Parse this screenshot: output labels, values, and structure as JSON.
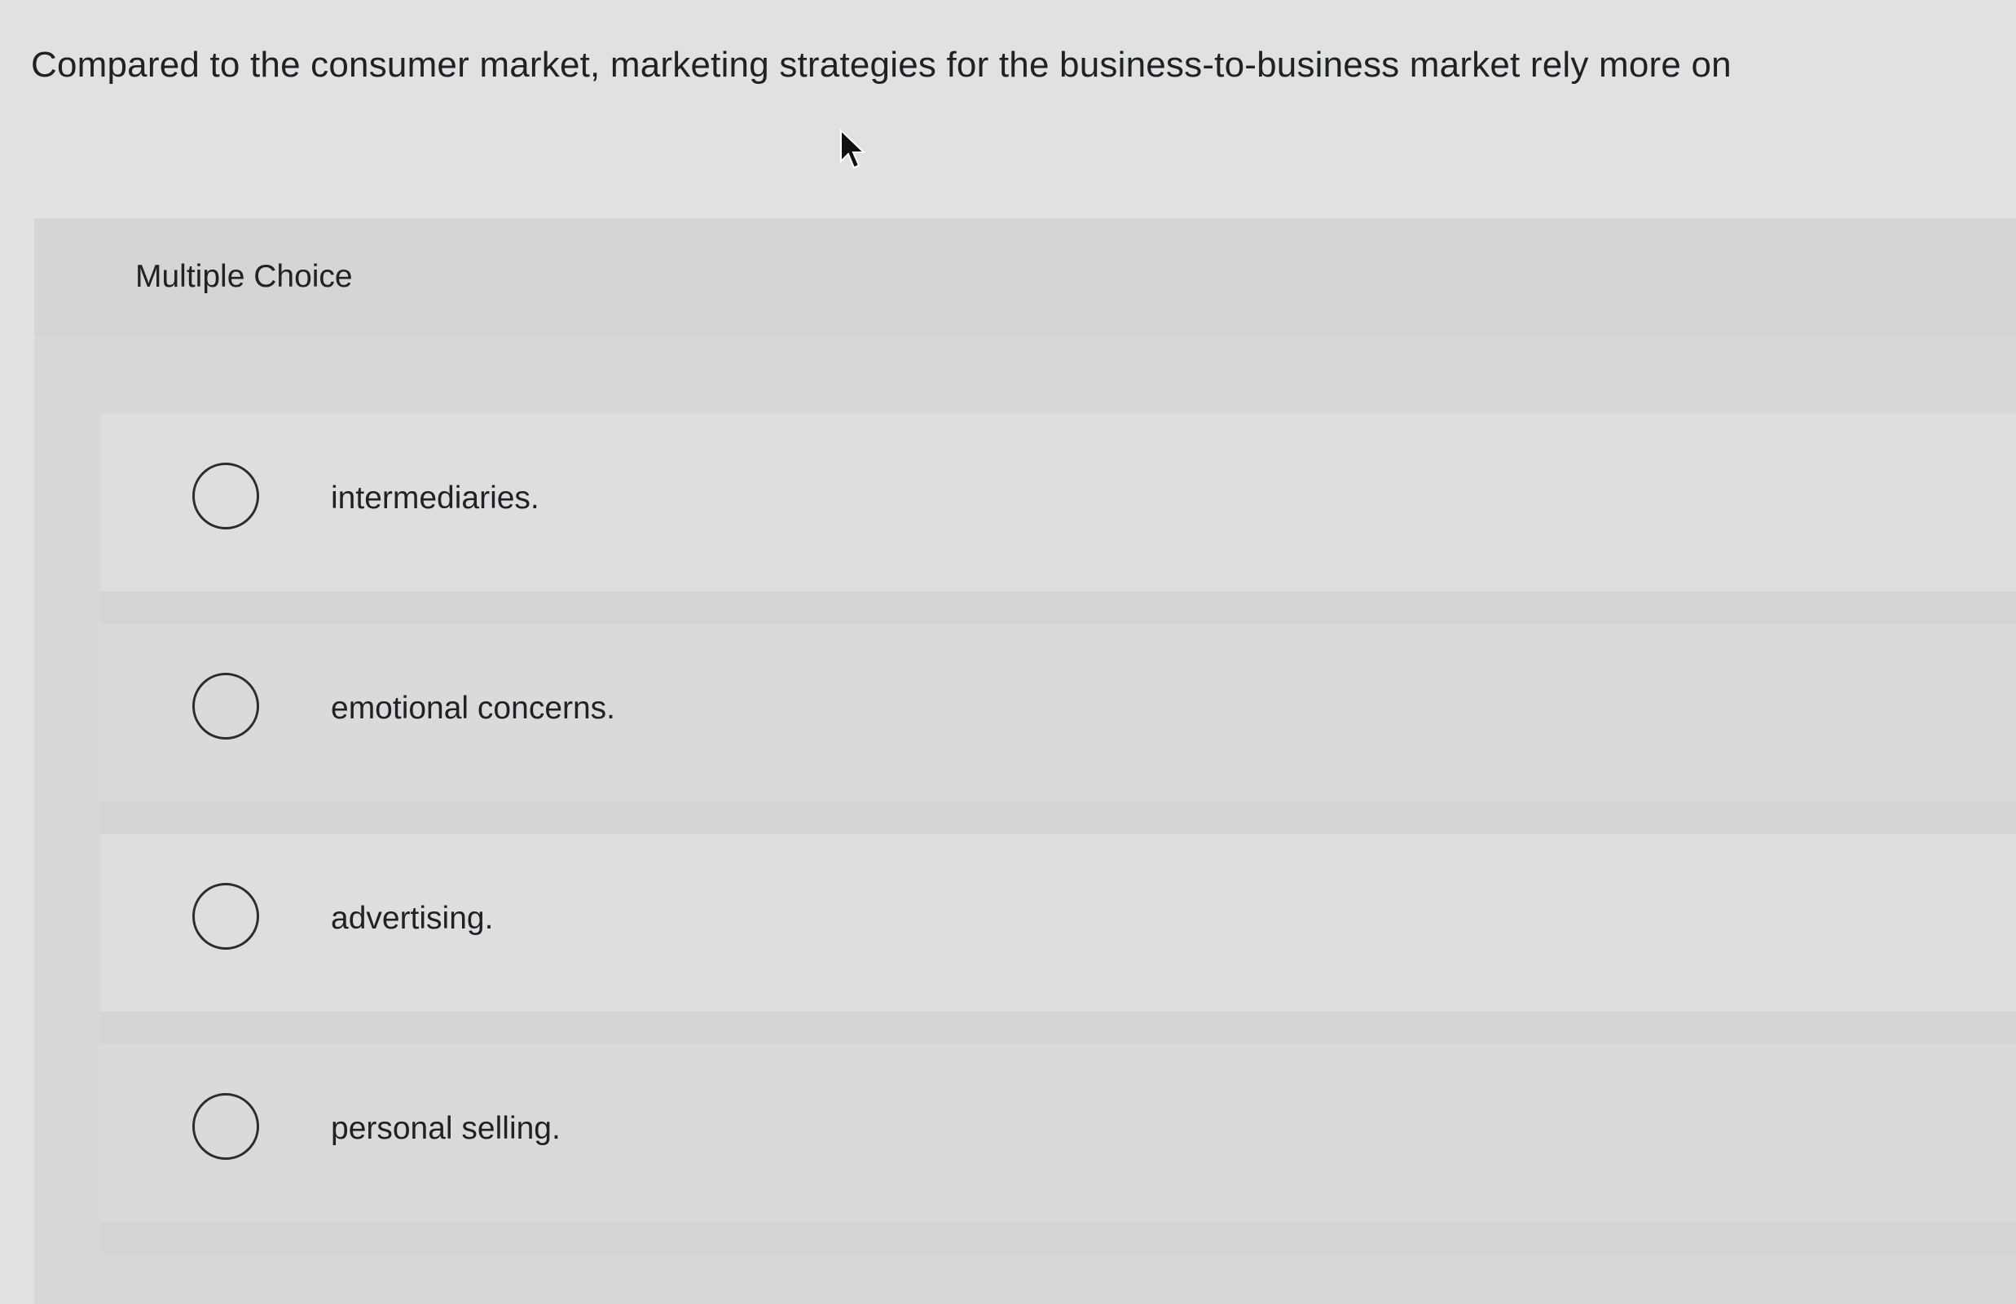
{
  "question": {
    "text": "Compared to the consumer market, marketing strategies for the business-to-business market rely more on"
  },
  "section": {
    "type_label": "Multiple Choice"
  },
  "options": [
    {
      "label": "intermediaries."
    },
    {
      "label": "emotional concerns."
    },
    {
      "label": "advertising."
    },
    {
      "label": "personal selling."
    }
  ],
  "icons": {
    "cursor": "mouse-pointer-icon",
    "radio": "radio-unselected-icon"
  }
}
